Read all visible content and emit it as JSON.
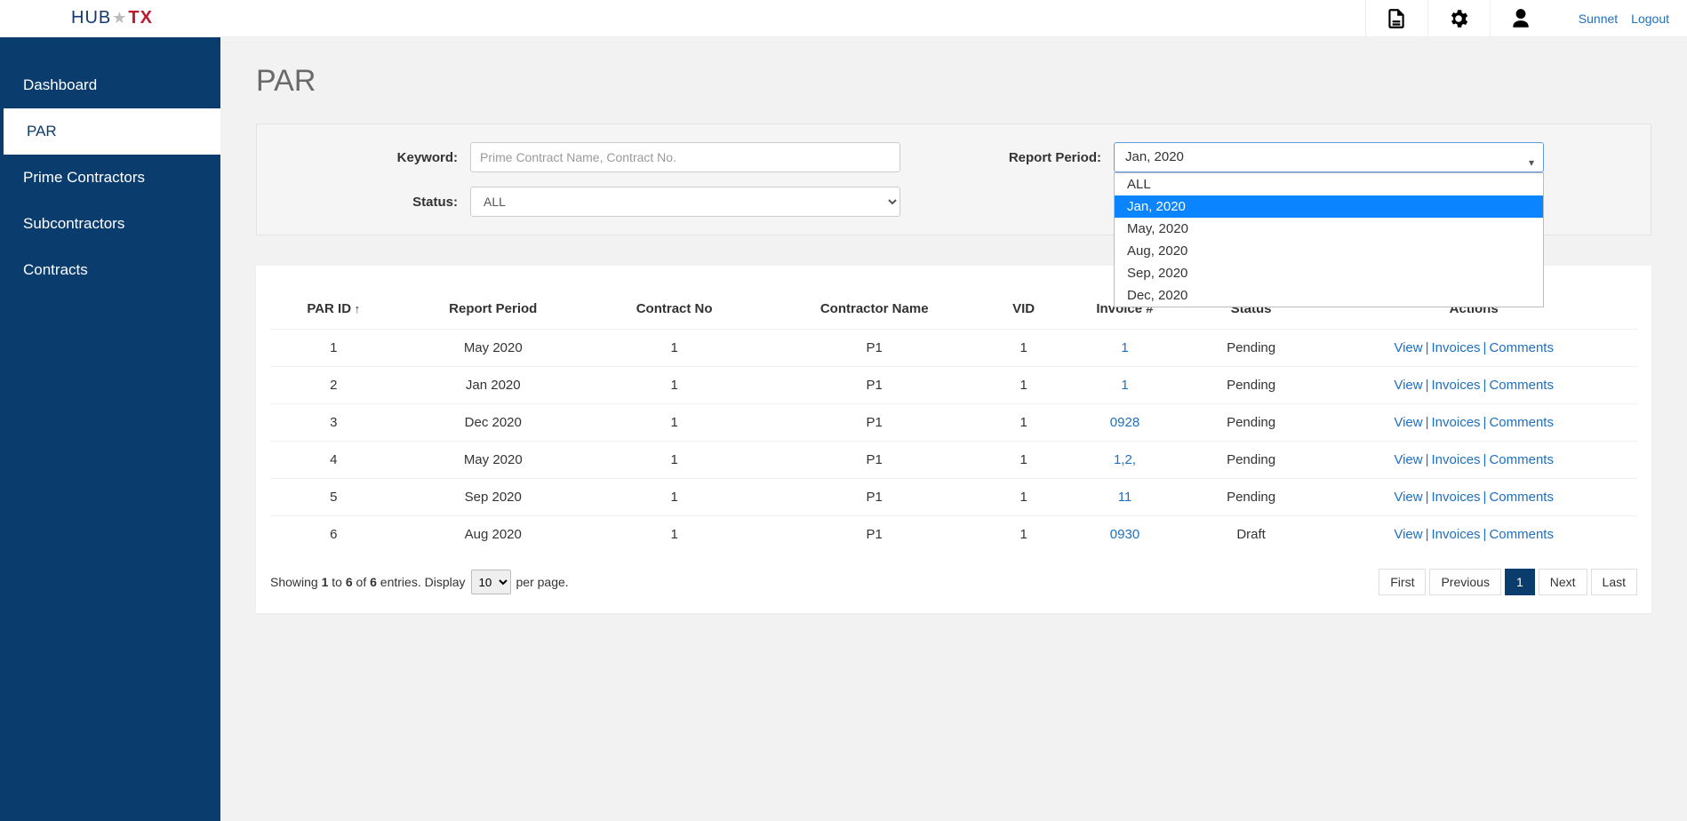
{
  "topbar": {
    "logo": {
      "part1": "HUB",
      "star": "★",
      "part2": "TX"
    },
    "links": {
      "user": "Sunnet",
      "logout": "Logout"
    }
  },
  "sidebar": {
    "items": [
      {
        "label": "Dashboard",
        "active": false
      },
      {
        "label": "PAR",
        "active": true
      },
      {
        "label": "Prime Contractors",
        "active": false
      },
      {
        "label": "Subcontractors",
        "active": false
      },
      {
        "label": "Contracts",
        "active": false
      }
    ]
  },
  "page": {
    "title": "PAR"
  },
  "filters": {
    "keyword": {
      "label": "Keyword:",
      "placeholder": "Prime Contract Name, Contract No."
    },
    "status": {
      "label": "Status:",
      "value": "ALL"
    },
    "period": {
      "label": "Report Period:",
      "value": "Jan, 2020",
      "options": [
        "ALL",
        "Jan, 2020",
        "May, 2020",
        "Aug, 2020",
        "Sep, 2020",
        "Dec, 2020"
      ],
      "highlightIndex": 1
    }
  },
  "table": {
    "columns": [
      "PAR ID",
      "Report Period",
      "Contract No",
      "Contractor Name",
      "VID",
      "Invoice #",
      "Status",
      "Actions"
    ],
    "rows": [
      {
        "id": "1",
        "period": "May 2020",
        "contract": "1",
        "contractor": "P1",
        "vid": "1",
        "invoice": "1",
        "status": "Pending"
      },
      {
        "id": "2",
        "period": "Jan 2020",
        "contract": "1",
        "contractor": "P1",
        "vid": "1",
        "invoice": "1",
        "status": "Pending"
      },
      {
        "id": "3",
        "period": "Dec 2020",
        "contract": "1",
        "contractor": "P1",
        "vid": "1",
        "invoice": "0928",
        "status": "Pending"
      },
      {
        "id": "4",
        "period": "May 2020",
        "contract": "1",
        "contractor": "P1",
        "vid": "1",
        "invoice": "1,2,",
        "status": "Pending"
      },
      {
        "id": "5",
        "period": "Sep 2020",
        "contract": "1",
        "contractor": "P1",
        "vid": "1",
        "invoice": "11",
        "status": "Pending"
      },
      {
        "id": "6",
        "period": "Aug 2020",
        "contract": "1",
        "contractor": "P1",
        "vid": "1",
        "invoice": "0930",
        "status": "Draft"
      }
    ],
    "actions": {
      "view": "View",
      "invoices": "Invoices",
      "comments": "Comments"
    }
  },
  "footer": {
    "showing_prefix": "Showing ",
    "from": "1",
    "to_word": " to ",
    "to": "6",
    "of_word": " of ",
    "total": "6",
    "entries_word": " entries. Display ",
    "per_page_value": "10",
    "per_page_suffix": " per page."
  },
  "pagination": {
    "first": "First",
    "previous": "Previous",
    "page": "1",
    "next": "Next",
    "last": "Last"
  }
}
